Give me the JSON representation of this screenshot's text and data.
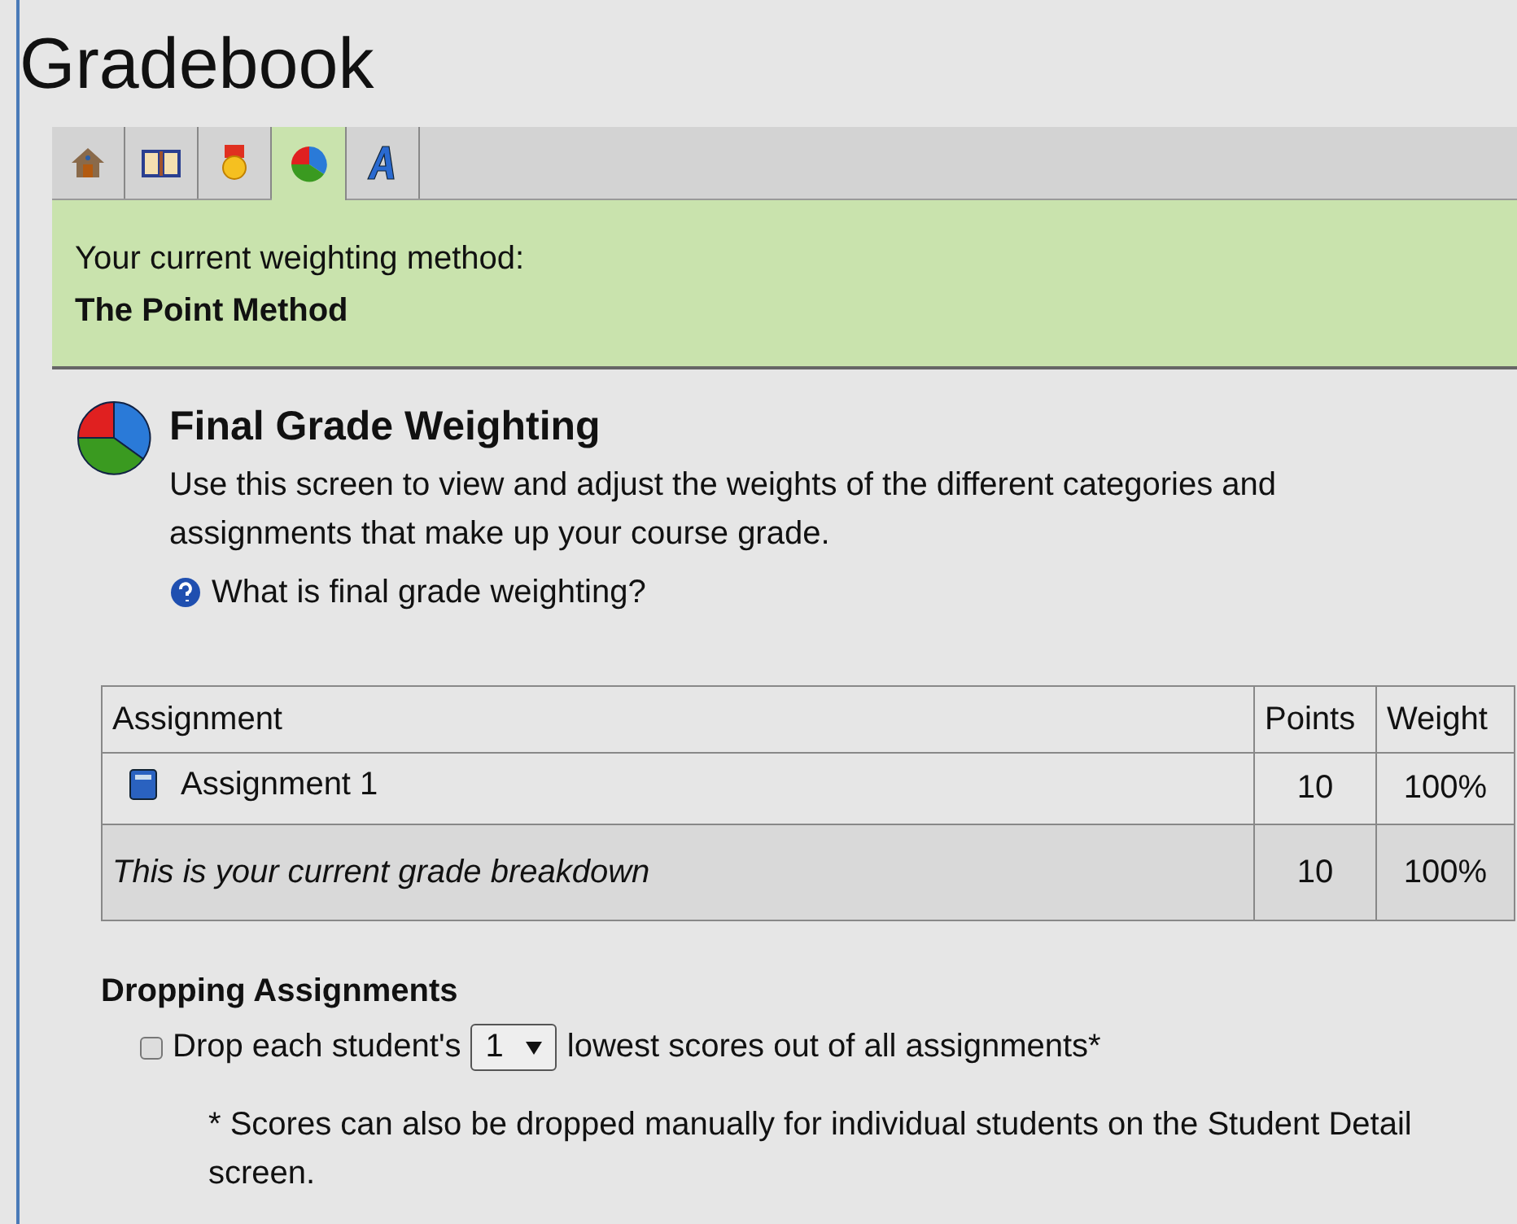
{
  "title": "Gradebook",
  "tabs": [
    {
      "kind": "home",
      "selected": false
    },
    {
      "kind": "book",
      "selected": false
    },
    {
      "kind": "medal",
      "selected": false
    },
    {
      "kind": "pie",
      "selected": true
    },
    {
      "kind": "letter",
      "selected": false
    }
  ],
  "banner": {
    "label": "Your current weighting method:",
    "method": "The Point Method"
  },
  "section": {
    "heading": "Final Grade Weighting",
    "description": "Use this screen to view and adjust the weights of the different categories and assignments that make up your course grade.",
    "help_link": "What is final grade weighting?"
  },
  "table": {
    "columns": [
      "Assignment",
      "Points",
      "Weight"
    ],
    "rows": [
      {
        "name": "Assignment 1",
        "points": "10",
        "weight": "100%"
      }
    ],
    "summary": {
      "label": "This is your current grade breakdown",
      "points": "10",
      "weight": "100%"
    }
  },
  "dropping": {
    "heading": "Dropping Assignments",
    "checked": false,
    "before": "Drop each student's",
    "count": "1",
    "after": "lowest scores out of all assignments*",
    "note": "* Scores can also be dropped manually for individual students on the Student Detail screen."
  }
}
